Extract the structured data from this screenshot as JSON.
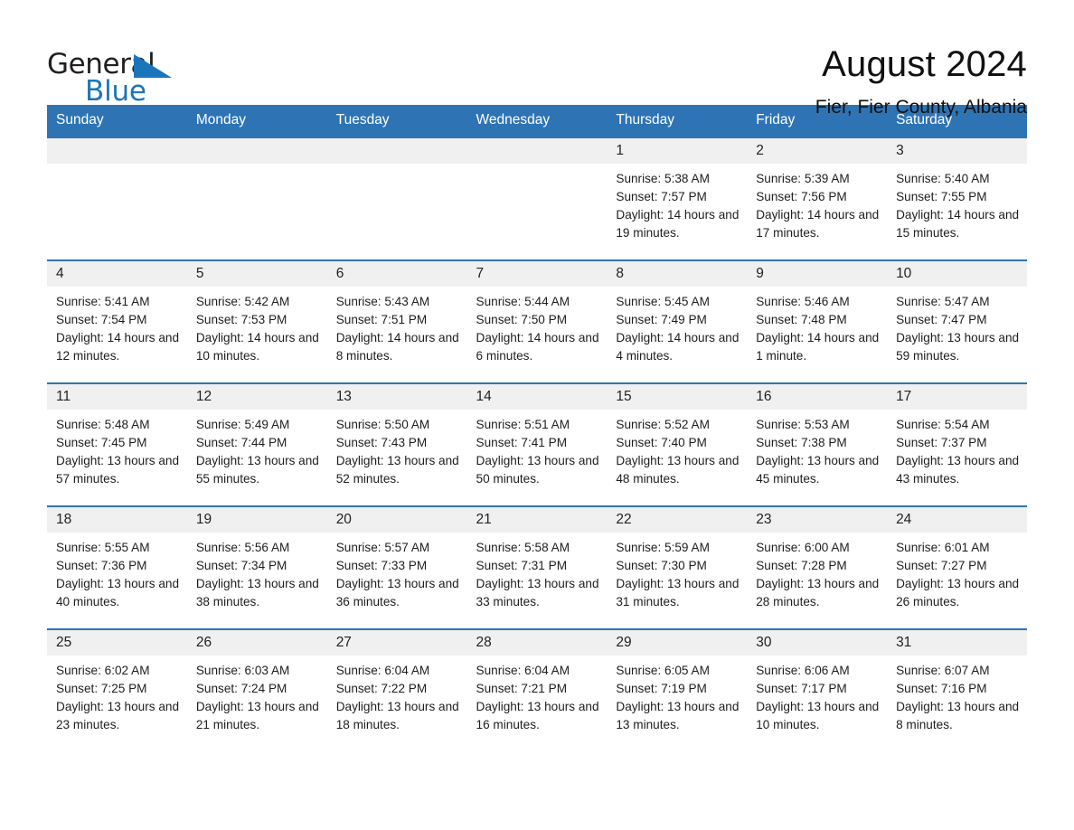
{
  "logo": {
    "word_one": "General",
    "word_two": "Blue",
    "triangle_icon": "blue-triangle-icon",
    "brand_color": "#1b75bb"
  },
  "header": {
    "title": "August 2024",
    "location": "Fier, Fier County, Albania"
  },
  "theme": {
    "header_blue": "#2e74b5",
    "daynum_gray": "#f0f0f0",
    "text": "#1e1e1e"
  },
  "calendar": {
    "weekdays": [
      "Sunday",
      "Monday",
      "Tuesday",
      "Wednesday",
      "Thursday",
      "Friday",
      "Saturday"
    ],
    "weeks": [
      [
        {
          "day": "",
          "empty": true
        },
        {
          "day": "",
          "empty": true
        },
        {
          "day": "",
          "empty": true
        },
        {
          "day": "",
          "empty": true
        },
        {
          "day": "1",
          "sunrise": "Sunrise: 5:38 AM",
          "sunset": "Sunset: 7:57 PM",
          "daylight": "Daylight: 14 hours and 19 minutes."
        },
        {
          "day": "2",
          "sunrise": "Sunrise: 5:39 AM",
          "sunset": "Sunset: 7:56 PM",
          "daylight": "Daylight: 14 hours and 17 minutes."
        },
        {
          "day": "3",
          "sunrise": "Sunrise: 5:40 AM",
          "sunset": "Sunset: 7:55 PM",
          "daylight": "Daylight: 14 hours and 15 minutes."
        }
      ],
      [
        {
          "day": "4",
          "sunrise": "Sunrise: 5:41 AM",
          "sunset": "Sunset: 7:54 PM",
          "daylight": "Daylight: 14 hours and 12 minutes."
        },
        {
          "day": "5",
          "sunrise": "Sunrise: 5:42 AM",
          "sunset": "Sunset: 7:53 PM",
          "daylight": "Daylight: 14 hours and 10 minutes."
        },
        {
          "day": "6",
          "sunrise": "Sunrise: 5:43 AM",
          "sunset": "Sunset: 7:51 PM",
          "daylight": "Daylight: 14 hours and 8 minutes."
        },
        {
          "day": "7",
          "sunrise": "Sunrise: 5:44 AM",
          "sunset": "Sunset: 7:50 PM",
          "daylight": "Daylight: 14 hours and 6 minutes."
        },
        {
          "day": "8",
          "sunrise": "Sunrise: 5:45 AM",
          "sunset": "Sunset: 7:49 PM",
          "daylight": "Daylight: 14 hours and 4 minutes."
        },
        {
          "day": "9",
          "sunrise": "Sunrise: 5:46 AM",
          "sunset": "Sunset: 7:48 PM",
          "daylight": "Daylight: 14 hours and 1 minute."
        },
        {
          "day": "10",
          "sunrise": "Sunrise: 5:47 AM",
          "sunset": "Sunset: 7:47 PM",
          "daylight": "Daylight: 13 hours and 59 minutes."
        }
      ],
      [
        {
          "day": "11",
          "sunrise": "Sunrise: 5:48 AM",
          "sunset": "Sunset: 7:45 PM",
          "daylight": "Daylight: 13 hours and 57 minutes."
        },
        {
          "day": "12",
          "sunrise": "Sunrise: 5:49 AM",
          "sunset": "Sunset: 7:44 PM",
          "daylight": "Daylight: 13 hours and 55 minutes."
        },
        {
          "day": "13",
          "sunrise": "Sunrise: 5:50 AM",
          "sunset": "Sunset: 7:43 PM",
          "daylight": "Daylight: 13 hours and 52 minutes."
        },
        {
          "day": "14",
          "sunrise": "Sunrise: 5:51 AM",
          "sunset": "Sunset: 7:41 PM",
          "daylight": "Daylight: 13 hours and 50 minutes."
        },
        {
          "day": "15",
          "sunrise": "Sunrise: 5:52 AM",
          "sunset": "Sunset: 7:40 PM",
          "daylight": "Daylight: 13 hours and 48 minutes."
        },
        {
          "day": "16",
          "sunrise": "Sunrise: 5:53 AM",
          "sunset": "Sunset: 7:38 PM",
          "daylight": "Daylight: 13 hours and 45 minutes."
        },
        {
          "day": "17",
          "sunrise": "Sunrise: 5:54 AM",
          "sunset": "Sunset: 7:37 PM",
          "daylight": "Daylight: 13 hours and 43 minutes."
        }
      ],
      [
        {
          "day": "18",
          "sunrise": "Sunrise: 5:55 AM",
          "sunset": "Sunset: 7:36 PM",
          "daylight": "Daylight: 13 hours and 40 minutes."
        },
        {
          "day": "19",
          "sunrise": "Sunrise: 5:56 AM",
          "sunset": "Sunset: 7:34 PM",
          "daylight": "Daylight: 13 hours and 38 minutes."
        },
        {
          "day": "20",
          "sunrise": "Sunrise: 5:57 AM",
          "sunset": "Sunset: 7:33 PM",
          "daylight": "Daylight: 13 hours and 36 minutes."
        },
        {
          "day": "21",
          "sunrise": "Sunrise: 5:58 AM",
          "sunset": "Sunset: 7:31 PM",
          "daylight": "Daylight: 13 hours and 33 minutes."
        },
        {
          "day": "22",
          "sunrise": "Sunrise: 5:59 AM",
          "sunset": "Sunset: 7:30 PM",
          "daylight": "Daylight: 13 hours and 31 minutes."
        },
        {
          "day": "23",
          "sunrise": "Sunrise: 6:00 AM",
          "sunset": "Sunset: 7:28 PM",
          "daylight": "Daylight: 13 hours and 28 minutes."
        },
        {
          "day": "24",
          "sunrise": "Sunrise: 6:01 AM",
          "sunset": "Sunset: 7:27 PM",
          "daylight": "Daylight: 13 hours and 26 minutes."
        }
      ],
      [
        {
          "day": "25",
          "sunrise": "Sunrise: 6:02 AM",
          "sunset": "Sunset: 7:25 PM",
          "daylight": "Daylight: 13 hours and 23 minutes."
        },
        {
          "day": "26",
          "sunrise": "Sunrise: 6:03 AM",
          "sunset": "Sunset: 7:24 PM",
          "daylight": "Daylight: 13 hours and 21 minutes."
        },
        {
          "day": "27",
          "sunrise": "Sunrise: 6:04 AM",
          "sunset": "Sunset: 7:22 PM",
          "daylight": "Daylight: 13 hours and 18 minutes."
        },
        {
          "day": "28",
          "sunrise": "Sunrise: 6:04 AM",
          "sunset": "Sunset: 7:21 PM",
          "daylight": "Daylight: 13 hours and 16 minutes."
        },
        {
          "day": "29",
          "sunrise": "Sunrise: 6:05 AM",
          "sunset": "Sunset: 7:19 PM",
          "daylight": "Daylight: 13 hours and 13 minutes."
        },
        {
          "day": "30",
          "sunrise": "Sunrise: 6:06 AM",
          "sunset": "Sunset: 7:17 PM",
          "daylight": "Daylight: 13 hours and 10 minutes."
        },
        {
          "day": "31",
          "sunrise": "Sunrise: 6:07 AM",
          "sunset": "Sunset: 7:16 PM",
          "daylight": "Daylight: 13 hours and 8 minutes."
        }
      ]
    ]
  }
}
